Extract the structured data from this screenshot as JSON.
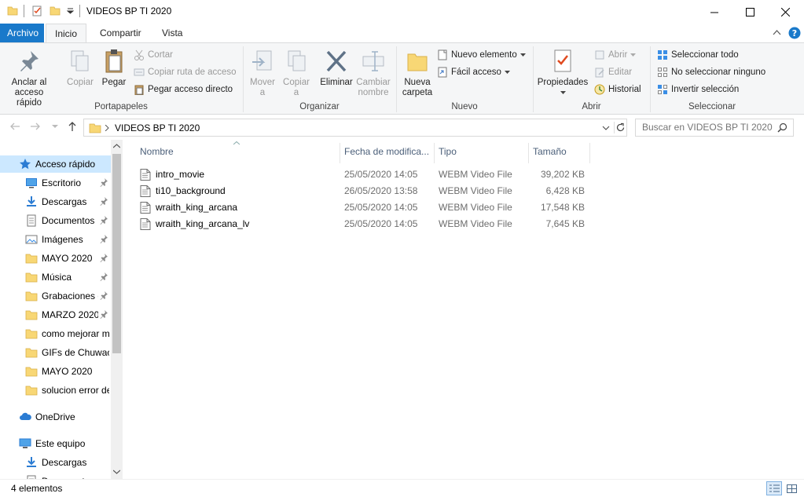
{
  "window": {
    "title": "VIDEOS BP TI 2020"
  },
  "ribbon": {
    "tabs": [
      "Archivo",
      "Inicio",
      "Compartir",
      "Vista"
    ],
    "groups": {
      "portapapeles": {
        "label": "Portapapeles",
        "anclar": [
          "Anclar al",
          "acceso rápido"
        ],
        "copiar": "Copiar",
        "pegar": "Pegar",
        "cortar": "Cortar",
        "copiar_ruta": "Copiar ruta de acceso",
        "pegar_acceso": "Pegar acceso directo"
      },
      "organizar": {
        "label": "Organizar",
        "mover": [
          "Mover",
          "a"
        ],
        "copiar_a": [
          "Copiar",
          "a"
        ],
        "eliminar": "Eliminar",
        "cambiar": [
          "Cambiar",
          "nombre"
        ]
      },
      "nuevo": {
        "label": "Nuevo",
        "nueva_carpeta": [
          "Nueva",
          "carpeta"
        ],
        "nuevo_elemento": "Nuevo elemento",
        "facil_acceso": "Fácil acceso"
      },
      "abrir": {
        "label": "Abrir",
        "propiedades": "Propiedades",
        "abrir": "Abrir",
        "editar": "Editar",
        "historial": "Historial"
      },
      "seleccionar": {
        "label": "Seleccionar",
        "todo": "Seleccionar todo",
        "ninguno": "No seleccionar ninguno",
        "invertir": "Invertir selección"
      }
    }
  },
  "address": {
    "path": "VIDEOS BP TI 2020",
    "search_placeholder": "Buscar en VIDEOS BP TI 2020"
  },
  "nav": {
    "items": [
      {
        "label": "Acceso rápido",
        "icon": "star-icon",
        "indent": 1,
        "pinned": false,
        "selected": true
      },
      {
        "label": "Escritorio",
        "icon": "desktop-icon",
        "indent": 2,
        "pinned": true
      },
      {
        "label": "Descargas",
        "icon": "download-icon",
        "indent": 2,
        "pinned": true
      },
      {
        "label": "Documentos",
        "icon": "documents-icon",
        "indent": 2,
        "pinned": true
      },
      {
        "label": "Imágenes",
        "icon": "pictures-icon",
        "indent": 2,
        "pinned": true
      },
      {
        "label": "MAYO 2020",
        "icon": "folder-icon",
        "indent": 2,
        "pinned": true
      },
      {
        "label": "Música",
        "icon": "folder-icon",
        "indent": 2,
        "pinned": true
      },
      {
        "label": "Grabaciones de pantalla",
        "icon": "folder-icon",
        "indent": 2,
        "pinned": true
      },
      {
        "label": "MARZO 2020",
        "icon": "folder-icon",
        "indent": 2,
        "pinned": true
      },
      {
        "label": "como mejorar mi pc",
        "icon": "folder-icon",
        "indent": 2,
        "pinned": false
      },
      {
        "label": "GIFs de Chuwaca",
        "icon": "folder-icon",
        "indent": 2,
        "pinned": false
      },
      {
        "label": "MAYO 2020",
        "icon": "folder-icon",
        "indent": 2,
        "pinned": false
      },
      {
        "label": "solucion error de",
        "icon": "folder-icon",
        "indent": 2,
        "pinned": false
      },
      {
        "label": "OneDrive",
        "icon": "cloud-icon",
        "indent": 1,
        "pinned": false,
        "gap": true
      },
      {
        "label": "Este equipo",
        "icon": "computer-icon",
        "indent": 1,
        "pinned": false,
        "gap": true
      },
      {
        "label": "Descargas",
        "icon": "download-icon",
        "indent": 2,
        "pinned": false
      },
      {
        "label": "Documentos",
        "icon": "documents-icon",
        "indent": 2,
        "pinned": false
      }
    ]
  },
  "files": {
    "columns": [
      "Nombre",
      "Fecha de modifica...",
      "Tipo",
      "Tamaño"
    ],
    "rows": [
      {
        "name": "intro_movie",
        "date": "25/05/2020 14:05",
        "type": "WEBM Video File",
        "size": "39,202 KB"
      },
      {
        "name": "ti10_background",
        "date": "26/05/2020 13:58",
        "type": "WEBM Video File",
        "size": "6,428 KB"
      },
      {
        "name": "wraith_king_arcana",
        "date": "25/05/2020 14:05",
        "type": "WEBM Video File",
        "size": "17,548 KB"
      },
      {
        "name": "wraith_king_arcana_lv",
        "date": "25/05/2020 14:05",
        "type": "WEBM Video File",
        "size": "7,645 KB"
      }
    ]
  },
  "status": {
    "count": "4 elementos"
  },
  "colors": {
    "accent": "#1979ca",
    "folder": "#f8d775",
    "selection": "#cce8ff"
  }
}
